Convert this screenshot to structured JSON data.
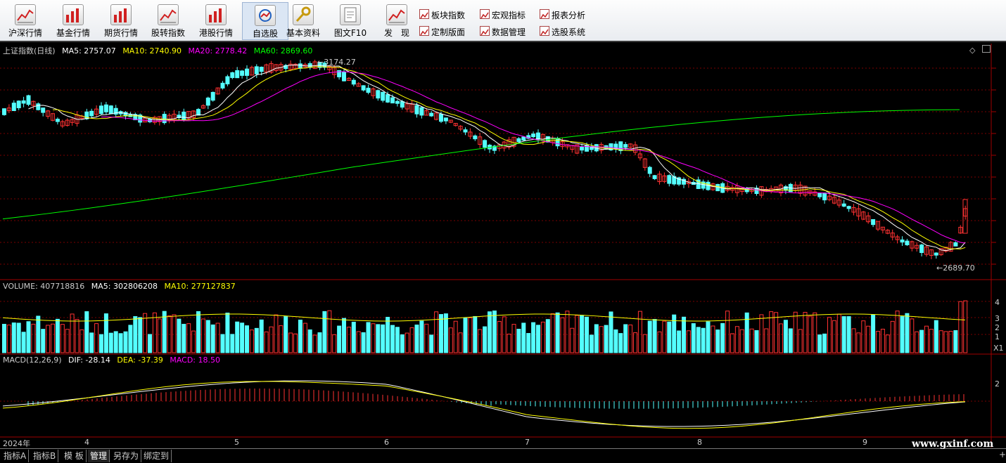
{
  "toolbar": {
    "big_buttons": [
      {
        "label": "沪深行情",
        "icon": "market-chart-icon"
      },
      {
        "label": "基金行情",
        "icon": "fund-chart-icon"
      },
      {
        "label": "期货行情",
        "icon": "futures-chart-icon"
      },
      {
        "label": "股转指数",
        "icon": "index-chart-icon"
      },
      {
        "label": "港股行情",
        "icon": "hk-chart-icon"
      },
      {
        "label": "自选股",
        "icon": "watchlist-icon"
      },
      {
        "label": "基本资料",
        "icon": "key-icon"
      },
      {
        "label": "图文F10",
        "icon": "document-icon"
      },
      {
        "label": "发　现",
        "icon": "discover-chart-icon"
      }
    ],
    "small_buttons": [
      {
        "label": "板块指数",
        "icon": "sector-icon"
      },
      {
        "label": "宏观指标",
        "icon": "macro-icon"
      },
      {
        "label": "报表分析",
        "icon": "report-icon"
      },
      {
        "label": "定制版面",
        "icon": "layout-icon"
      },
      {
        "label": "数据管理",
        "icon": "data-icon"
      },
      {
        "label": "选股系统",
        "icon": "screener-icon"
      }
    ]
  },
  "main_panel": {
    "title": "上证指数(日线)",
    "ma5": "MA5: 2757.07",
    "ma10": "MA10: 2740.90",
    "ma20": "MA20: 2778.42",
    "ma60": "MA60: 2869.60",
    "high_label": "3174.27",
    "low_label": "2689.70"
  },
  "volume_panel": {
    "vol": "VOLUME: 407718816",
    "ma5": "MA5: 302806208",
    "ma10": "MA10: 277127837",
    "axis": [
      "4",
      "3",
      "2",
      "1"
    ],
    "unit": "X1"
  },
  "macd_panel": {
    "title": "MACD(12,26,9)",
    "dif": "DIF: -28.14",
    "dea": "DEA: -37.39",
    "macd": "MACD: 18.50",
    "axis": [
      "2"
    ]
  },
  "x_axis": {
    "labels": [
      "2024年",
      "4",
      "5",
      "6",
      "7",
      "8",
      "9"
    ]
  },
  "bottom_tabs": [
    "指标A",
    "指标B",
    "模 板",
    "管理",
    "另存为",
    "绑定到"
  ],
  "watermark": "www.gxinf.com",
  "colors": {
    "up": "#ff3232",
    "down": "#54ffff",
    "ma5": "#ffffff",
    "ma10": "#ffff00",
    "ma20": "#ff00ff",
    "ma60": "#00ff00",
    "grid": "#7a0000"
  },
  "chart_data": {
    "type": "candlestick",
    "title": "上证指数(日线)",
    "high": 3174.27,
    "low": 2689.7,
    "last_ma": {
      "MA5": 2757.07,
      "MA10": 2740.9,
      "MA20": 2778.42,
      "MA60": 2869.6
    },
    "last_volume": 407718816,
    "volume_ma": {
      "MA5": 302806208,
      "MA10": 277127837
    },
    "macd": {
      "DIF": -28.14,
      "DEA": -37.39,
      "MACD": 18.5
    },
    "months": [
      "2024年",
      "4",
      "5",
      "6",
      "7",
      "8",
      "9"
    ]
  }
}
